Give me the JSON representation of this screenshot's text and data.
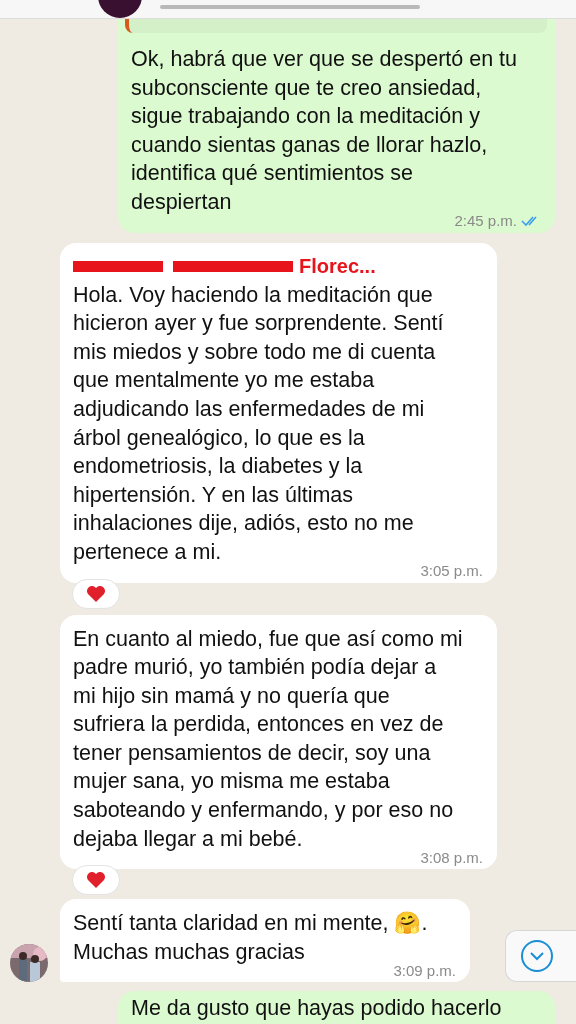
{
  "messages": [
    {
      "kind": "outgoing",
      "reply_preview": true,
      "lines": [
        "Ok, habrá que ver que se despertó en tu",
        "subconsciente que te creo ansiedad,",
        "sigue trabajando con la meditación y",
        "cuando sientas ganas de llorar hazlo,",
        "identifica qué sentimientos se",
        "despiertan"
      ],
      "time": "2:45 p.m.",
      "read": true
    },
    {
      "kind": "incoming",
      "sender": "Florec...",
      "lines": [
        "Hola. Voy haciendo la meditación que",
        "hicieron ayer y fue sorprendente. Sentí",
        "mis miedos y sobre todo me di cuenta",
        "que mentalmente yo me estaba",
        "adjudicando las enfermedades de mi",
        "árbol genealógico, lo que es la",
        "endometriosis, la diabetes y la",
        "hipertensión. Y en las últimas",
        "inhalaciones dije, adiós, esto no me",
        "pertenece a mi."
      ],
      "time": "3:05 p.m.",
      "reaction": true
    },
    {
      "kind": "incoming",
      "lines": [
        "En cuanto al miedo, fue que así como mi",
        "padre murió, yo también podía dejar a",
        "mi hijo sin mamá y no quería que",
        "sufriera la perdida, entonces en vez de",
        "tener pensamientos de decir, soy una",
        "mujer sana, yo misma me estaba",
        "saboteando y enfermando, y por eso no",
        "dejaba llegar a mi bebé."
      ],
      "time": "3:08 p.m.",
      "reaction": true
    },
    {
      "kind": "incoming",
      "avatar": true,
      "lines": [
        "Sentí tanta claridad en mi mente, 🤗.",
        "Muchas muchas gracias"
      ],
      "time": "3:09 p.m."
    },
    {
      "kind": "outgoing",
      "lines": [
        "Me da gusto que hayas podido hacerlo"
      ]
    }
  ]
}
